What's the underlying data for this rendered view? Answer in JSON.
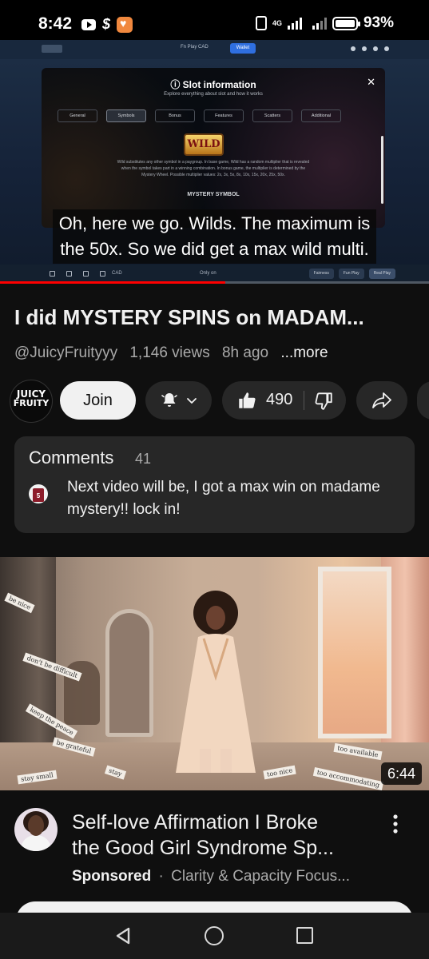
{
  "status_bar": {
    "time": "8:42",
    "battery": "93%",
    "network": "4G"
  },
  "player": {
    "caption_line1": "Oh, here we go. Wilds. The maximum is",
    "caption_line2": "the 50x. So we did get a max wild multi.",
    "progress_fraction": 0.525,
    "progress_color": "#ff0000",
    "embedded_game": {
      "top_mode": "Fn Play  CAD",
      "wallet": "Wallet",
      "modal_title": "Slot information",
      "modal_subtitle": "Explore everything about slot and how it works",
      "tabs": [
        "General",
        "Symbols",
        "Bonus",
        "Features",
        "Scatters",
        "Additional"
      ],
      "active_tab": "Symbols",
      "symbol": "WILD",
      "symbol_text": "Wild substitutes any other symbol in a paygroup. In base game, Wild has a random multiplier that is revealed when the symbol takes part in a winning combination. In bonus game, the multiplier is determined by the Mystery Wheel. Possible multiplier values: 2x, 3x, 5x, 8x, 10x, 15x, 20x, 25x, 50x.",
      "section_label": "MYSTERY SYMBOL",
      "bottom_currency": "CAD",
      "bottom_only": "Only on",
      "bottom_buttons": [
        "Fairness",
        "Fun Play",
        "Real Play"
      ]
    }
  },
  "video": {
    "title": "I did MYSTERY SPINS on MADAM...",
    "channel_handle": "@JuicyFruityyy",
    "views": "1,146 views",
    "age": "8h ago",
    "more": "...more"
  },
  "channel": {
    "avatar_line1": "JUICY",
    "avatar_line2": "FRUITY"
  },
  "actions": {
    "join_label": "Join",
    "like_count": "490"
  },
  "comments": {
    "title": "Comments",
    "count": "41",
    "top_comment": "Next video will be, I got a max win on madame mystery!! lock in!",
    "avatar_jersey_number": "5"
  },
  "sponsored": {
    "duration": "6:44",
    "title_line1": "Self-love Affirmation I Broke",
    "title_line2": "the Good Girl Syndrome Sp...",
    "badge": "Sponsored",
    "separator": "·",
    "advertiser": "Clarity & Capacity Focus...",
    "thumbnail_notes": [
      "be nice",
      "don't be difficult",
      "keep the peace",
      "be grateful",
      "stay small",
      "too nice",
      "too accommodating",
      "too available",
      "stay"
    ]
  },
  "colors": {
    "background": "#0f0f0f",
    "pill": "#272727",
    "secondary_text": "#aaaaaa",
    "primary_text": "#f1f1f1"
  },
  "icons": {
    "bell": "bell-icon",
    "like": "thumbs-up-icon",
    "dislike": "thumbs-down-icon",
    "share": "share-icon",
    "more": "kebab-icon"
  }
}
